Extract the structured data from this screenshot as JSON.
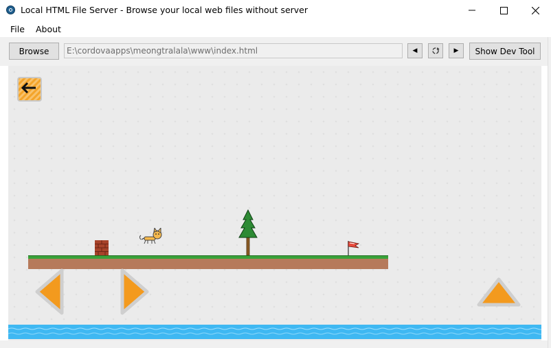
{
  "window": {
    "title": "Local HTML File Server - Browse your local web files without server"
  },
  "menu": {
    "items": [
      "File",
      "About"
    ]
  },
  "toolbar": {
    "browse_label": "Browse",
    "path_value": "E:\\cordovaapps\\meongtralala\\www\\index.html",
    "back_glyph": "◀",
    "forward_glyph": "▶",
    "devtool_label": "Show Dev Tool"
  },
  "game": {
    "back_button_icon": "arrow-left-icon",
    "controls": [
      "left-arrow-icon",
      "right-arrow-icon",
      "up-arrow-icon"
    ],
    "sprites": [
      "brick-block",
      "cat-player",
      "pine-tree",
      "goal-flag"
    ],
    "colors": {
      "ground_dirt": "#b67a5b",
      "ground_grass": "#3aa23a",
      "water": "#3fb8f2",
      "control_orange": "#f39a1e"
    }
  }
}
